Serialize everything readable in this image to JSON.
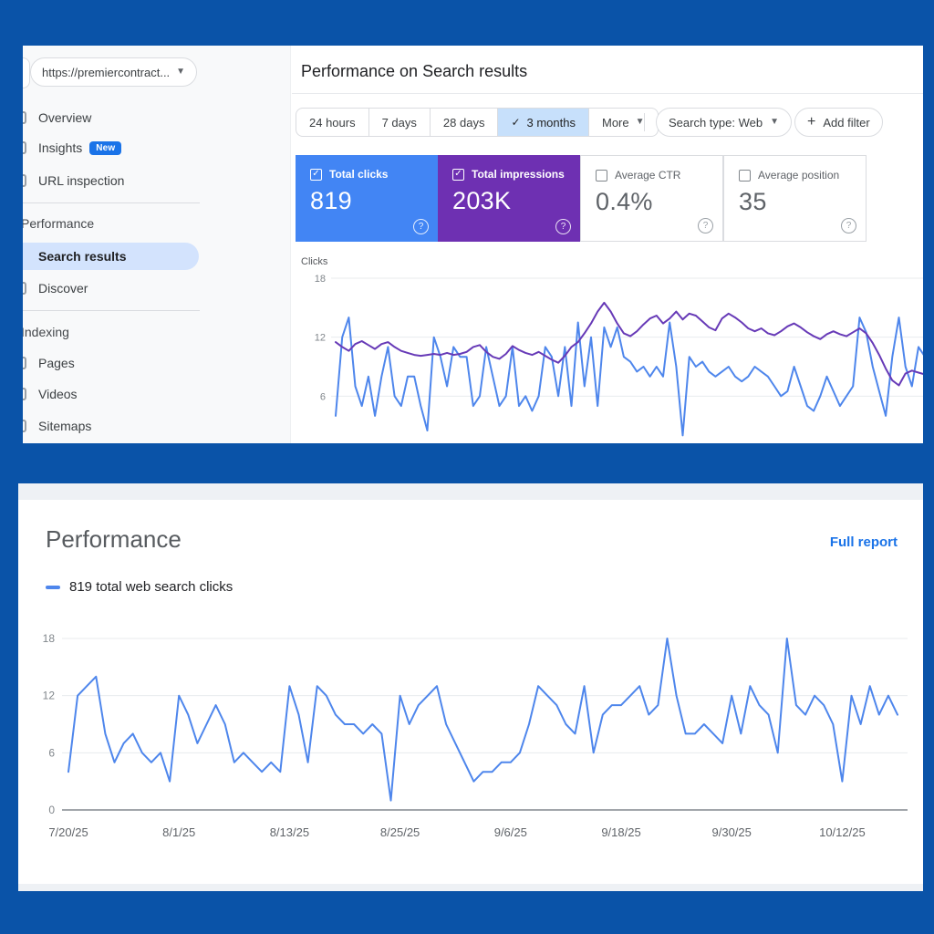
{
  "colors": {
    "frame_bg": "#0a53a8",
    "clicks_blue": "#4e86ec",
    "impressions_purple": "#673ab7",
    "card_blue": "#4285f4",
    "card_purple": "#6e30b2",
    "link_blue": "#1a73e8",
    "selected_nav_pill": "#d3e3fd",
    "selected_segment": "#c7e0fb"
  },
  "top_panel": {
    "property_selector": {
      "label": "https://premiercontract...",
      "caret": "▾"
    },
    "sidebar": {
      "items": [
        {
          "label": "Overview"
        },
        {
          "label": "Insights",
          "badge": "New"
        },
        {
          "label": "URL inspection"
        }
      ],
      "section_performance": "Performance",
      "performance_items": [
        {
          "label": "Search results",
          "selected": true
        },
        {
          "label": "Discover"
        }
      ],
      "section_indexing": "Indexing",
      "indexing_items": [
        {
          "label": "Pages"
        },
        {
          "label": "Videos"
        },
        {
          "label": "Sitemaps"
        }
      ]
    },
    "title": "Performance on Search results",
    "filters": {
      "range_options": [
        "24 hours",
        "7 days",
        "28 days",
        "3 months"
      ],
      "selected_range": "3 months",
      "selected_check": "✓",
      "more": "More",
      "search_type": "Search type: Web",
      "add_filter": "Add filter",
      "plus": "+"
    },
    "cards": [
      {
        "label": "Total clicks",
        "value": "819",
        "checked": true
      },
      {
        "label": "Total impressions",
        "value": "203K",
        "checked": true
      },
      {
        "label": "Average CTR",
        "value": "0.4%",
        "checked": false
      },
      {
        "label": "Average position",
        "value": "35",
        "checked": false
      }
    ],
    "help_glyph": "?"
  },
  "bottom_panel": {
    "title": "Performance",
    "link": "Full report",
    "legend": "819 total web search clicks"
  },
  "chart_data": [
    {
      "type": "line",
      "title": "Search performance over 3 months",
      "ylabel": "Clicks",
      "ylim": [
        0,
        18
      ],
      "y_ticks": [
        18,
        12,
        6
      ],
      "grid": true,
      "legend_position": "none",
      "x_days": 91,
      "series": [
        {
          "name": "Total clicks",
          "color": "#4e86ec",
          "values": [
            4,
            12,
            14,
            7,
            5,
            8,
            4,
            8,
            11,
            6,
            5,
            8,
            8,
            5,
            2.5,
            12,
            10,
            7,
            11,
            10,
            10,
            5,
            6,
            11,
            8,
            5,
            6,
            11,
            5,
            6,
            4.5,
            6,
            11,
            10,
            6,
            11,
            5,
            13.5,
            7,
            12,
            5,
            13,
            11,
            13,
            10,
            9.5,
            8.5,
            9,
            8,
            9,
            8,
            13.5,
            9,
            2,
            10,
            9,
            9.5,
            8.5,
            8,
            8.5,
            9,
            8,
            7.5,
            8,
            9,
            8.5,
            8,
            7,
            6,
            6.5,
            9,
            7,
            5,
            4.5,
            6,
            8,
            6.5,
            5,
            6,
            7,
            14,
            12.5,
            9,
            6.5,
            4,
            10,
            14,
            9,
            7,
            11,
            10
          ]
        },
        {
          "name": "Total impressions (scaled)",
          "color": "#673ab7",
          "values": [
            11.5,
            11,
            10.6,
            11.3,
            11.6,
            11.2,
            10.8,
            11.3,
            11.5,
            11,
            10.6,
            10.4,
            10.2,
            10.1,
            10.2,
            10.3,
            10.2,
            10.4,
            10.2,
            10.3,
            10.5,
            11,
            11.2,
            10.5,
            10,
            9.8,
            10.3,
            11.1,
            10.7,
            10.4,
            10.2,
            10.5,
            10.1,
            9.7,
            9.4,
            10.1,
            11,
            11.5,
            12.4,
            13.4,
            14.6,
            15.5,
            14.6,
            13.4,
            12.4,
            12.1,
            12.6,
            13.3,
            13.9,
            14.2,
            13.4,
            13.9,
            14.6,
            13.8,
            14.4,
            14.2,
            13.6,
            13,
            12.7,
            13.9,
            14.4,
            14,
            13.5,
            12.9,
            12.6,
            12.9,
            12.4,
            12.2,
            12.6,
            13.1,
            13.4,
            13,
            12.5,
            12.1,
            11.8,
            12.3,
            12.6,
            12.3,
            12.1,
            12.5,
            12.9,
            12.4,
            11.4,
            10.2,
            8.8,
            7.6,
            7.1,
            8.3,
            8.6,
            8.4,
            8.2
          ]
        }
      ]
    },
    {
      "type": "line",
      "title": "819 total web search clicks",
      "ylabel": "",
      "ylim": [
        0,
        18
      ],
      "y_ticks": [
        18,
        12,
        6,
        0
      ],
      "grid": true,
      "legend_position": "top-left",
      "x_tick_labels": [
        "7/20/25",
        "8/1/25",
        "8/13/25",
        "8/25/25",
        "9/6/25",
        "9/18/25",
        "9/30/25",
        "10/12/25"
      ],
      "x_tick_days": [
        0,
        12,
        24,
        36,
        48,
        60,
        72,
        84
      ],
      "x_days": 91,
      "series": [
        {
          "name": "819 total web search clicks",
          "color": "#4e86ec",
          "values": [
            4,
            12,
            13,
            14,
            8,
            5,
            7,
            8,
            6,
            5,
            6,
            3,
            12,
            10,
            7,
            9,
            11,
            9,
            5,
            6,
            5,
            4,
            5,
            4,
            13,
            10,
            5,
            13,
            12,
            10,
            9,
            9,
            8,
            9,
            8,
            1,
            12,
            9,
            11,
            12,
            13,
            9,
            7,
            5,
            3,
            4,
            4,
            5,
            5,
            6,
            9,
            13,
            12,
            11,
            9,
            8,
            13,
            6,
            10,
            11,
            11,
            12,
            13,
            10,
            11,
            18,
            12,
            8,
            8,
            9,
            8,
            7,
            12,
            8,
            13,
            11,
            10,
            6,
            18,
            11,
            10,
            12,
            11,
            9,
            3,
            12,
            9,
            13,
            10,
            12,
            10
          ]
        }
      ]
    }
  ]
}
